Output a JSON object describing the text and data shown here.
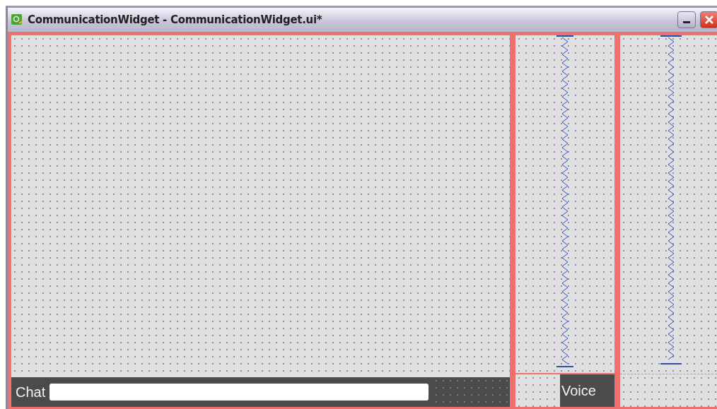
{
  "window": {
    "title": "CommunicationWidget - CommunicationWidget.ui*"
  },
  "chat": {
    "label": "Chat"
  },
  "voice": {
    "label": "Voice"
  }
}
